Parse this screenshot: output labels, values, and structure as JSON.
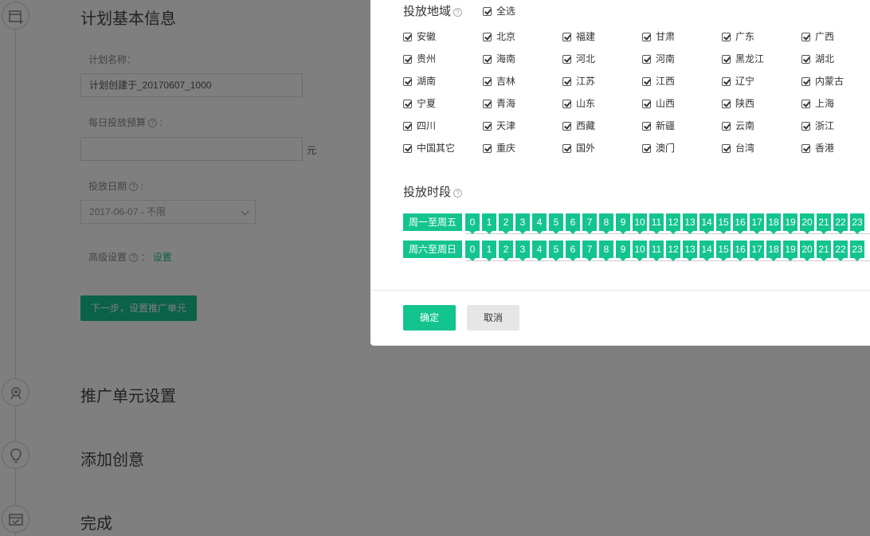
{
  "background": {
    "steps": [
      {
        "title": "计划基本信息",
        "icon": "calendar-plus-icon"
      },
      {
        "title": "推广单元设置",
        "icon": "target-icon"
      },
      {
        "title": "添加创意",
        "icon": "lightbulb-icon"
      },
      {
        "title": "完成",
        "icon": "calendar-check-icon"
      }
    ],
    "form": {
      "plan_name_label": "计划名称：",
      "plan_name_value": "计划创建于_20170607_1000",
      "budget_label": "每日投放预算",
      "budget_value": "",
      "budget_unit": "元",
      "date_label": "投放日期",
      "date_value": "2017-06-07 - 不限",
      "advanced_label": "高级设置",
      "advanced_link": "设置",
      "next_button": "下一步，设置推广单元"
    }
  },
  "modal": {
    "region_title": "投放地域",
    "select_all": "全选",
    "regions": [
      "安徽",
      "北京",
      "福建",
      "甘肃",
      "广东",
      "广西",
      "贵州",
      "海南",
      "河北",
      "河南",
      "黑龙江",
      "湖北",
      "湖南",
      "吉林",
      "江苏",
      "江西",
      "辽宁",
      "内蒙古",
      "宁夏",
      "青海",
      "山东",
      "山西",
      "陕西",
      "上海",
      "四川",
      "天津",
      "西藏",
      "新疆",
      "云南",
      "浙江",
      "中国其它",
      "重庆",
      "国外",
      "澳门",
      "台湾",
      "香港"
    ],
    "time_title": "投放时段",
    "time_rows": [
      {
        "label": "周一至周五"
      },
      {
        "label": "周六至周日"
      }
    ],
    "hours": [
      "0",
      "1",
      "2",
      "3",
      "4",
      "5",
      "6",
      "7",
      "8",
      "9",
      "10",
      "11",
      "12",
      "13",
      "14",
      "15",
      "16",
      "17",
      "18",
      "19",
      "20",
      "21",
      "22",
      "23"
    ],
    "confirm": "确定",
    "cancel": "取消"
  },
  "colors": {
    "accent": "#14c48e",
    "overlay": "rgba(0,0,0,0.5)"
  }
}
